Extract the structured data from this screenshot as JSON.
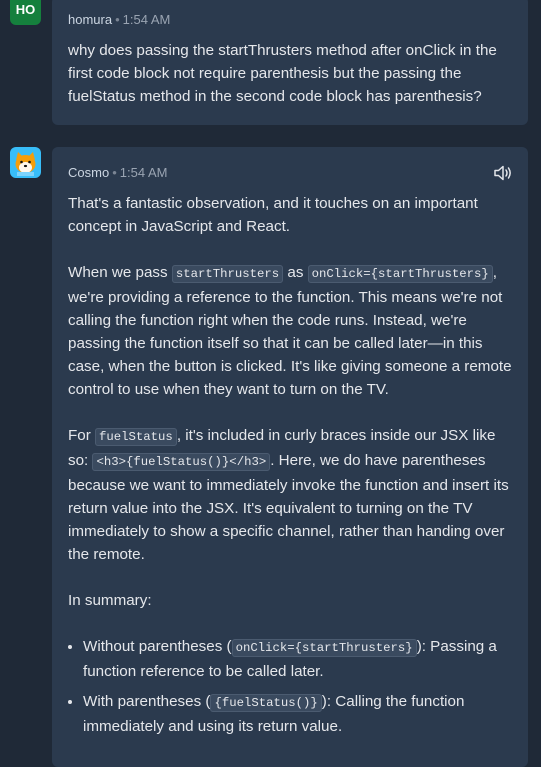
{
  "user": {
    "avatar_initials": "HO",
    "avatar_color": "#15803d",
    "name": "homura",
    "time": "1:54 AM",
    "message": "why does passing the startThrusters method after onClick in the first code block not require parenthesis but the passing the fuelStatus method in the second code block has parenthesis?"
  },
  "bot": {
    "avatar_icon": "shiba-dog-avatar-icon",
    "name": "Cosmo",
    "time": "1:54 AM",
    "speaker_icon": "speaker-icon",
    "p1": "That's a fantastic observation, and it touches on an important concept in JavaScript and React.",
    "p2": {
      "a": "When we pass ",
      "code1": "startThrusters",
      "b": " as ",
      "code2": "onClick={startThrusters}",
      "c": ", we're providing a reference to the function. This means we're not calling the function right when the code runs. Instead, we're passing the function itself so that it can be called later—in this case, when the button is clicked. It's like giving someone a remote control to use when they want to turn on the TV."
    },
    "p3": {
      "a": "For ",
      "code1": "fuelStatus",
      "b": ", it's included in curly braces inside our JSX like so: ",
      "code2": "<h3>{fuelStatus()}</h3>",
      "c": ". Here, we do have parentheses because we want to immediately invoke the function and insert its return value into the JSX. It's equivalent to turning on the TV immediately to show a specific channel, rather than handing over the remote."
    },
    "p4": "In summary:",
    "bullets": [
      {
        "a": "Without parentheses (",
        "code": "onClick={startThrusters}",
        "b": "): Passing a function reference to be called later."
      },
      {
        "a": "With parentheses (",
        "code": "{fuelStatus()}",
        "b": "): Calling the function immediately and using its return value."
      }
    ],
    "colors": {
      "card_bg": "#2b3a4e",
      "page_bg": "#1f2937"
    }
  }
}
